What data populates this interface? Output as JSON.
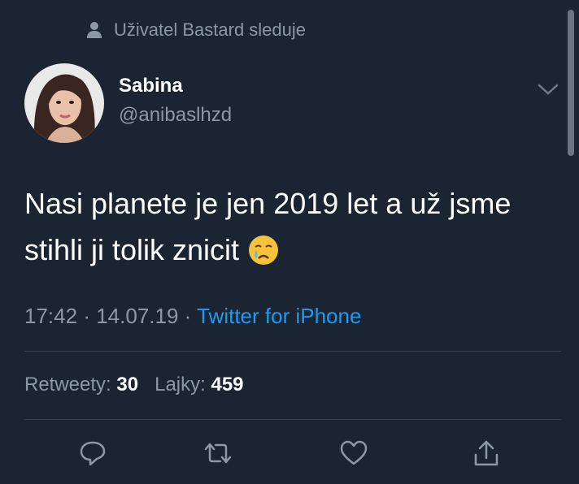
{
  "context": {
    "followed_text": "Uživatel Bastard sleduje"
  },
  "author": {
    "name": "Sabina",
    "handle": "@anibaslhzd"
  },
  "tweet": {
    "text_line1": "Nasi planete je jen 2019 let a už jsme",
    "text_line2": "stihli ji tolik znicit",
    "emoji": "crying-face-icon",
    "time": "17:42",
    "date": "14.07.19",
    "separator": "·",
    "source": "Twitter for iPhone"
  },
  "stats": {
    "retweets_label": "Retweety:",
    "retweets_count": "30",
    "likes_label": "Lajky:",
    "likes_count": "459"
  },
  "actions": [
    "reply-icon",
    "retweet-icon",
    "like-icon",
    "share-icon"
  ],
  "colors": {
    "background": "#1b2433",
    "secondary_text": "#8b98a5",
    "link": "#1d9bf0",
    "divider": "#38444d"
  }
}
